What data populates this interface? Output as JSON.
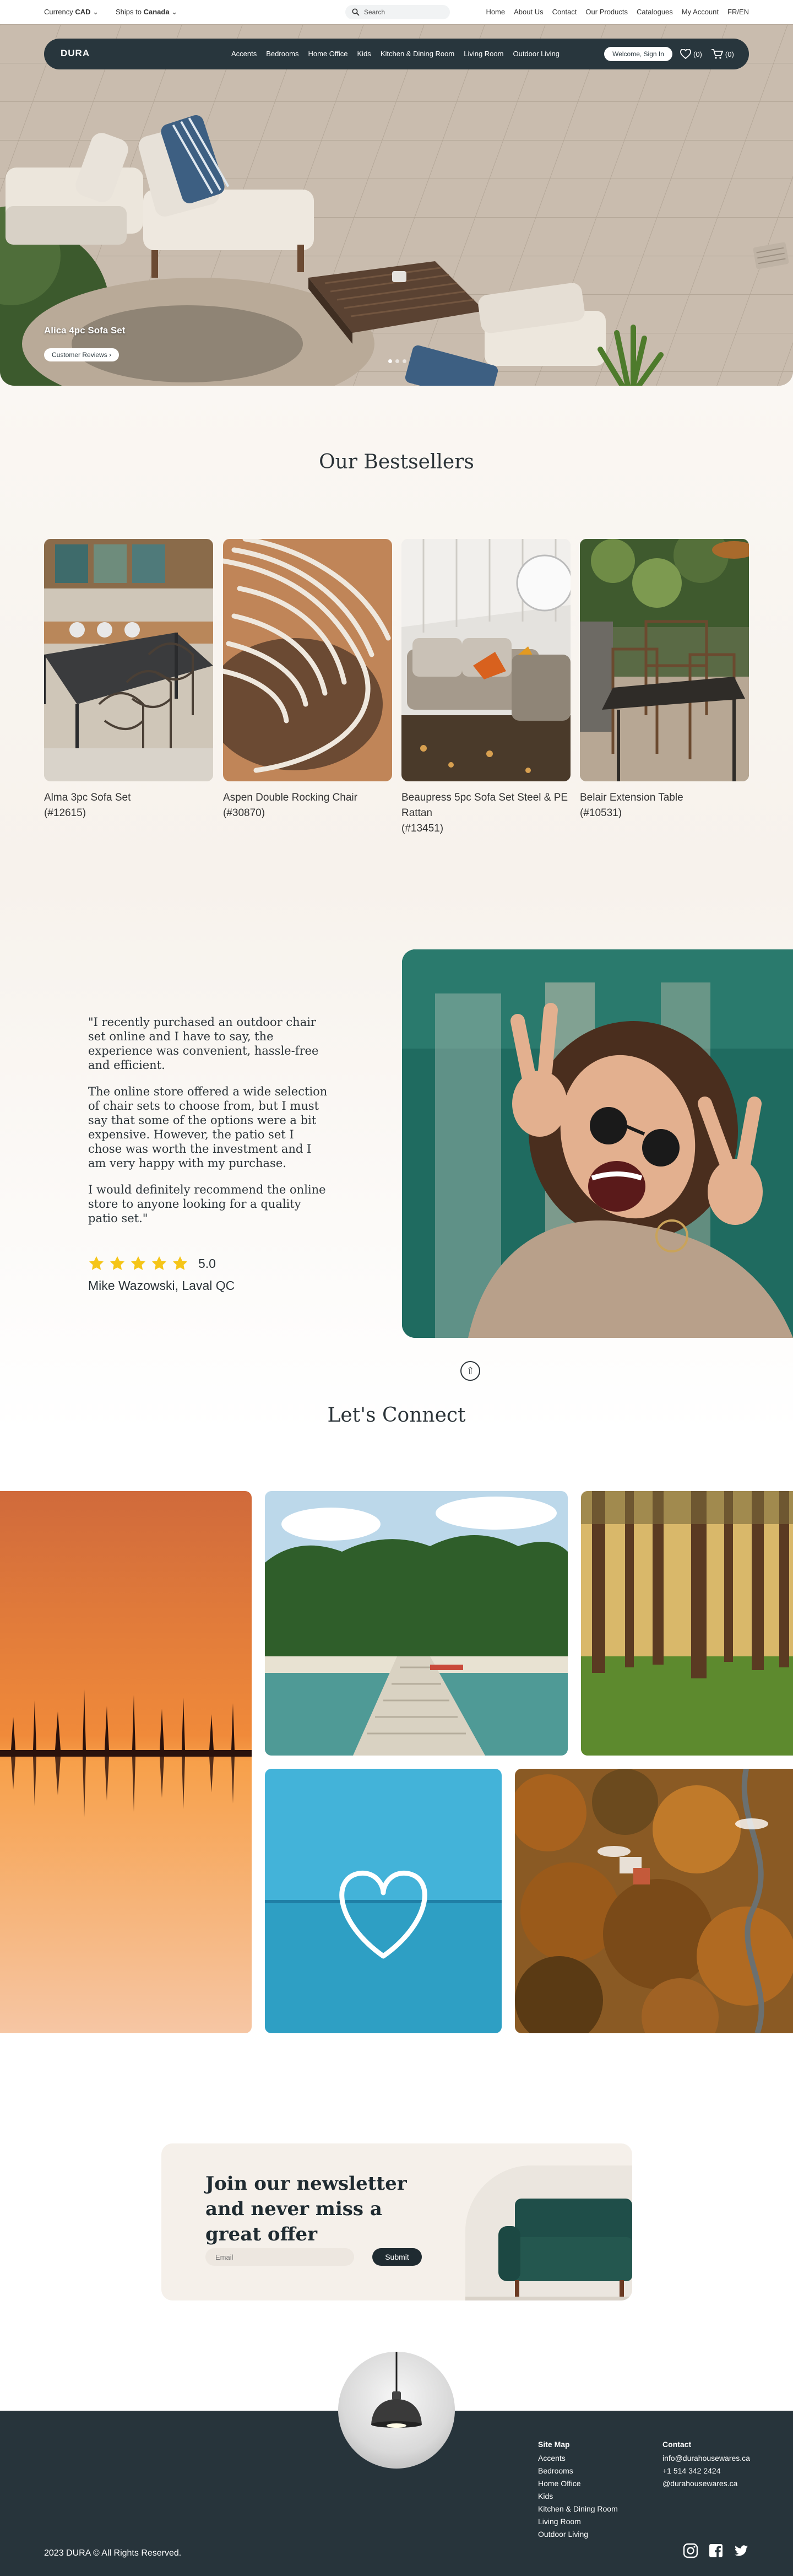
{
  "topbar": {
    "currency_label": "Currency",
    "currency_value": "CAD",
    "ships_label": "Ships to",
    "ships_value": "Canada",
    "search_placeholder": "Search",
    "links": [
      "Home",
      "About Us",
      "Contact",
      "Our Products",
      "Catalogues",
      "My Account",
      "FR/EN"
    ]
  },
  "nav": {
    "logo": "DURA",
    "links": [
      "Accents",
      "Bedrooms",
      "Home Office",
      "Kids",
      "Kitchen & Dining Room",
      "Living Room",
      "Outdoor Living"
    ],
    "signin": "Welcome, Sign In",
    "wishlist_count": "(0)",
    "cart_count": "(0)"
  },
  "hero": {
    "title": "Alica 4pc Sofa Set",
    "button": "Customer Reviews",
    "button_arrow": "›",
    "slides": 3,
    "active_slide": 1
  },
  "bestsellers": {
    "heading": "Our Bestsellers",
    "products": [
      {
        "name": "Alma 3pc Sofa Set",
        "sku": "(#12615)"
      },
      {
        "name": "Aspen Double Rocking Chair",
        "sku": "(#30870)"
      },
      {
        "name": "Beaupress 5pc Sofa Set Steel & PE Rattan",
        "sku": "(#13451)"
      },
      {
        "name": "Belair Extension Table",
        "sku": "(#10531)"
      }
    ]
  },
  "testimonial": {
    "paragraphs": [
      "\"I recently purchased an outdoor chair set online and I have to say, the experience was convenient, hassle-free and efficient.",
      "The online store offered a wide selection of chair sets to choose from, but I must say that some of the options were a bit expensive. However, the patio set I chose was worth the investment and I am very happy with my purchase.",
      "I would definitely recommend the online store to anyone looking for a quality patio set.\""
    ],
    "stars": 5,
    "rating": "5.0",
    "author": "Mike Wazowski, Laval QC",
    "up_icon": "⇧"
  },
  "connect": {
    "heading": "Let's Connect"
  },
  "newsletter": {
    "heading": "Join our newsletter and never miss a great offer",
    "email_placeholder": "Email",
    "submit": "Submit"
  },
  "footer": {
    "sitemap_title": "Site Map",
    "sitemap": [
      "Accents",
      "Bedrooms",
      "Home Office",
      "Kids",
      "Kitchen & Dining Room",
      "Living Room",
      "Outdoor Living"
    ],
    "contact_title": "Contact",
    "contact": [
      "info@durahousewares.ca",
      "+1 514 342 2424",
      "@durahousewares.ca"
    ],
    "copyright": "2023 DURA © All Rights Reserved."
  },
  "colors": {
    "dark": "#28363d",
    "star": "#f5c518"
  }
}
